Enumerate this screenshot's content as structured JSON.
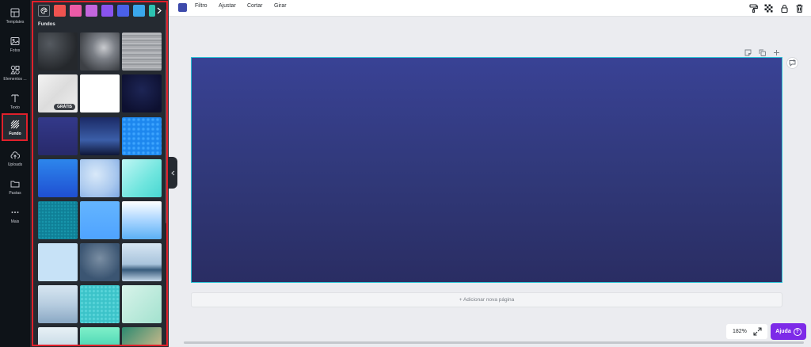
{
  "sidebar": {
    "items": [
      {
        "label": "Templates",
        "icon": "template-icon"
      },
      {
        "label": "Fotos",
        "icon": "photo-icon"
      },
      {
        "label": "Elementos ...",
        "icon": "elements-icon"
      },
      {
        "label": "Texto",
        "icon": "text-icon"
      },
      {
        "label": "Fundo",
        "icon": "background-icon",
        "active": true
      },
      {
        "label": "Uploads",
        "icon": "upload-icon"
      },
      {
        "label": "Pastas",
        "icon": "folder-icon"
      },
      {
        "label": "Mais",
        "icon": "more-icon"
      }
    ]
  },
  "panel": {
    "colors": [
      "#ef5350",
      "#ec5ba7",
      "#c466de",
      "#8a53ee",
      "#4a60e8",
      "#3aa7ec",
      "#2dc3b2"
    ],
    "section_title": "Fundos",
    "badge_label": "GRÁTIS"
  },
  "toolbar": {
    "color": "#3d4aab",
    "filter_label": "Filtro",
    "adjust_label": "Ajustar",
    "crop_label": "Cortar",
    "rotate_label": "Girar"
  },
  "canvas": {
    "add_page_label": "+ Adicionar nova página",
    "border_color": "#2bc4d6"
  },
  "footer": {
    "zoom": "182%",
    "help_label": "Ajuda"
  }
}
